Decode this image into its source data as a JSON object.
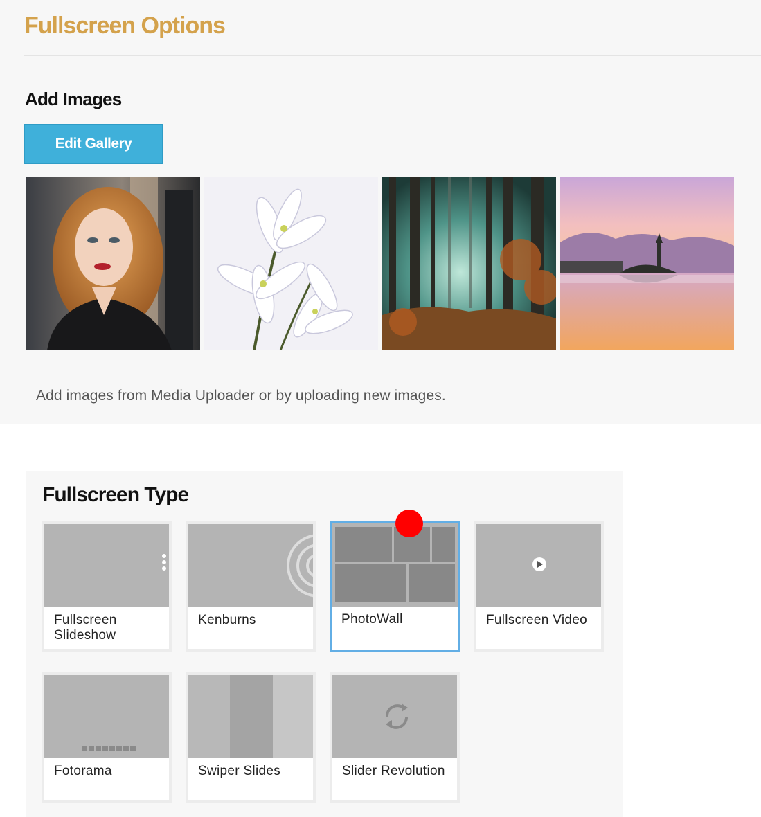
{
  "options_panel": {
    "title": "Fullscreen Options",
    "add_images_heading": "Add Images",
    "edit_gallery_label": "Edit Gallery",
    "gallery_images": [
      {
        "name": "portrait-woman-image"
      },
      {
        "name": "white-flowers-image"
      },
      {
        "name": "misty-forest-image"
      },
      {
        "name": "lake-island-sunset-image"
      }
    ],
    "help_text": "Add images from Media Uploader or by uploading new images."
  },
  "type_panel": {
    "heading": "Fullscreen Type",
    "selected": "PhotoWall",
    "types": [
      {
        "label": "Fullscreen Slideshow"
      },
      {
        "label": "Kenburns"
      },
      {
        "label": "PhotoWall"
      },
      {
        "label": "Fullscreen Video"
      },
      {
        "label": "Fotorama"
      },
      {
        "label": "Swiper Slides"
      },
      {
        "label": "Slider Revolution"
      }
    ]
  },
  "colors": {
    "title_gold": "#d4a24c",
    "button_blue": "#3fb0da",
    "selected_border": "#62aee5",
    "preview_gray": "#b4b4b4",
    "cursor_marker": "#ff0000"
  }
}
